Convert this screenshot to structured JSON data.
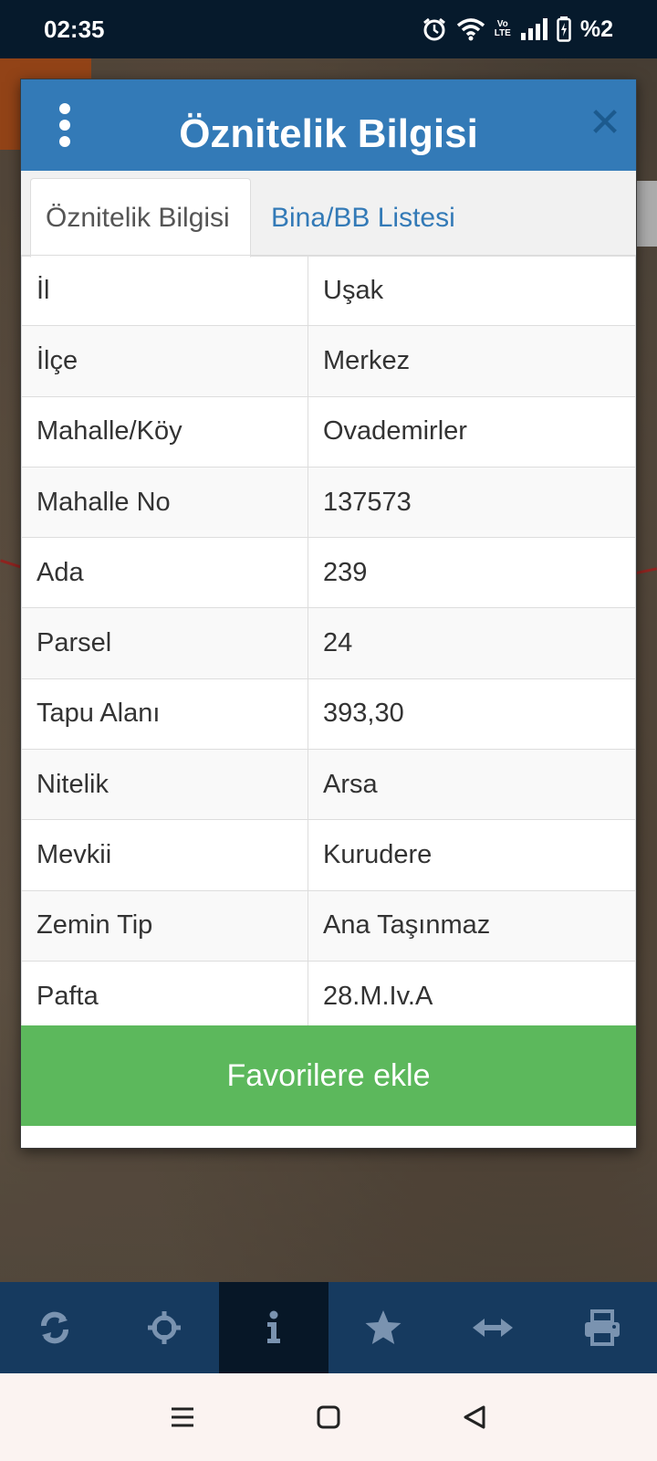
{
  "status_bar": {
    "time": "02:35",
    "battery_text": "%2",
    "volte_top": "Vo",
    "volte_bottom": "LTE",
    "icons": [
      "alarm-icon",
      "wifi-icon",
      "volte-icon",
      "signal-icon",
      "battery-charging-icon"
    ]
  },
  "dialog": {
    "title": "Öznitelik Bilgisi",
    "menu_icon": "vertical-dots-icon",
    "close_icon": "close-icon",
    "tabs": [
      {
        "label": "Öznitelik Bilgisi",
        "active": true
      },
      {
        "label": "Bina/BB Listesi",
        "active": false
      }
    ],
    "rows": [
      {
        "key": "İl",
        "value": "Uşak"
      },
      {
        "key": "İlçe",
        "value": "Merkez"
      },
      {
        "key": "Mahalle/Köy",
        "value": "Ovademirler"
      },
      {
        "key": "Mahalle No",
        "value": "137573"
      },
      {
        "key": "Ada",
        "value": "239"
      },
      {
        "key": "Parsel",
        "value": "24"
      },
      {
        "key": "Tapu Alanı",
        "value": "393,30"
      },
      {
        "key": "Nitelik",
        "value": "Arsa"
      },
      {
        "key": "Mevkii",
        "value": "Kurudere"
      },
      {
        "key": "Zemin Tip",
        "value": "Ana Taşınmaz"
      },
      {
        "key": "Pafta",
        "value": "28.M.Iv.A"
      }
    ],
    "favorite_button": "Favorilere ekle"
  },
  "toolbar": {
    "items": [
      {
        "icon": "refresh-icon",
        "active": false
      },
      {
        "icon": "crosshair-icon",
        "active": false
      },
      {
        "icon": "info-icon",
        "active": true
      },
      {
        "icon": "star-icon",
        "active": false
      },
      {
        "icon": "measure-arrows-icon",
        "active": false
      },
      {
        "icon": "print-icon",
        "active": false
      }
    ]
  },
  "navigation": {
    "icons": [
      "menu-icon",
      "home-square-icon",
      "back-triangle-icon"
    ]
  },
  "colors": {
    "header_blue": "#337ab7",
    "button_green": "#5cb85c",
    "toolbar_blue": "#163a5f",
    "toolbar_active": "#071727",
    "status_bar": "#061a2c"
  }
}
